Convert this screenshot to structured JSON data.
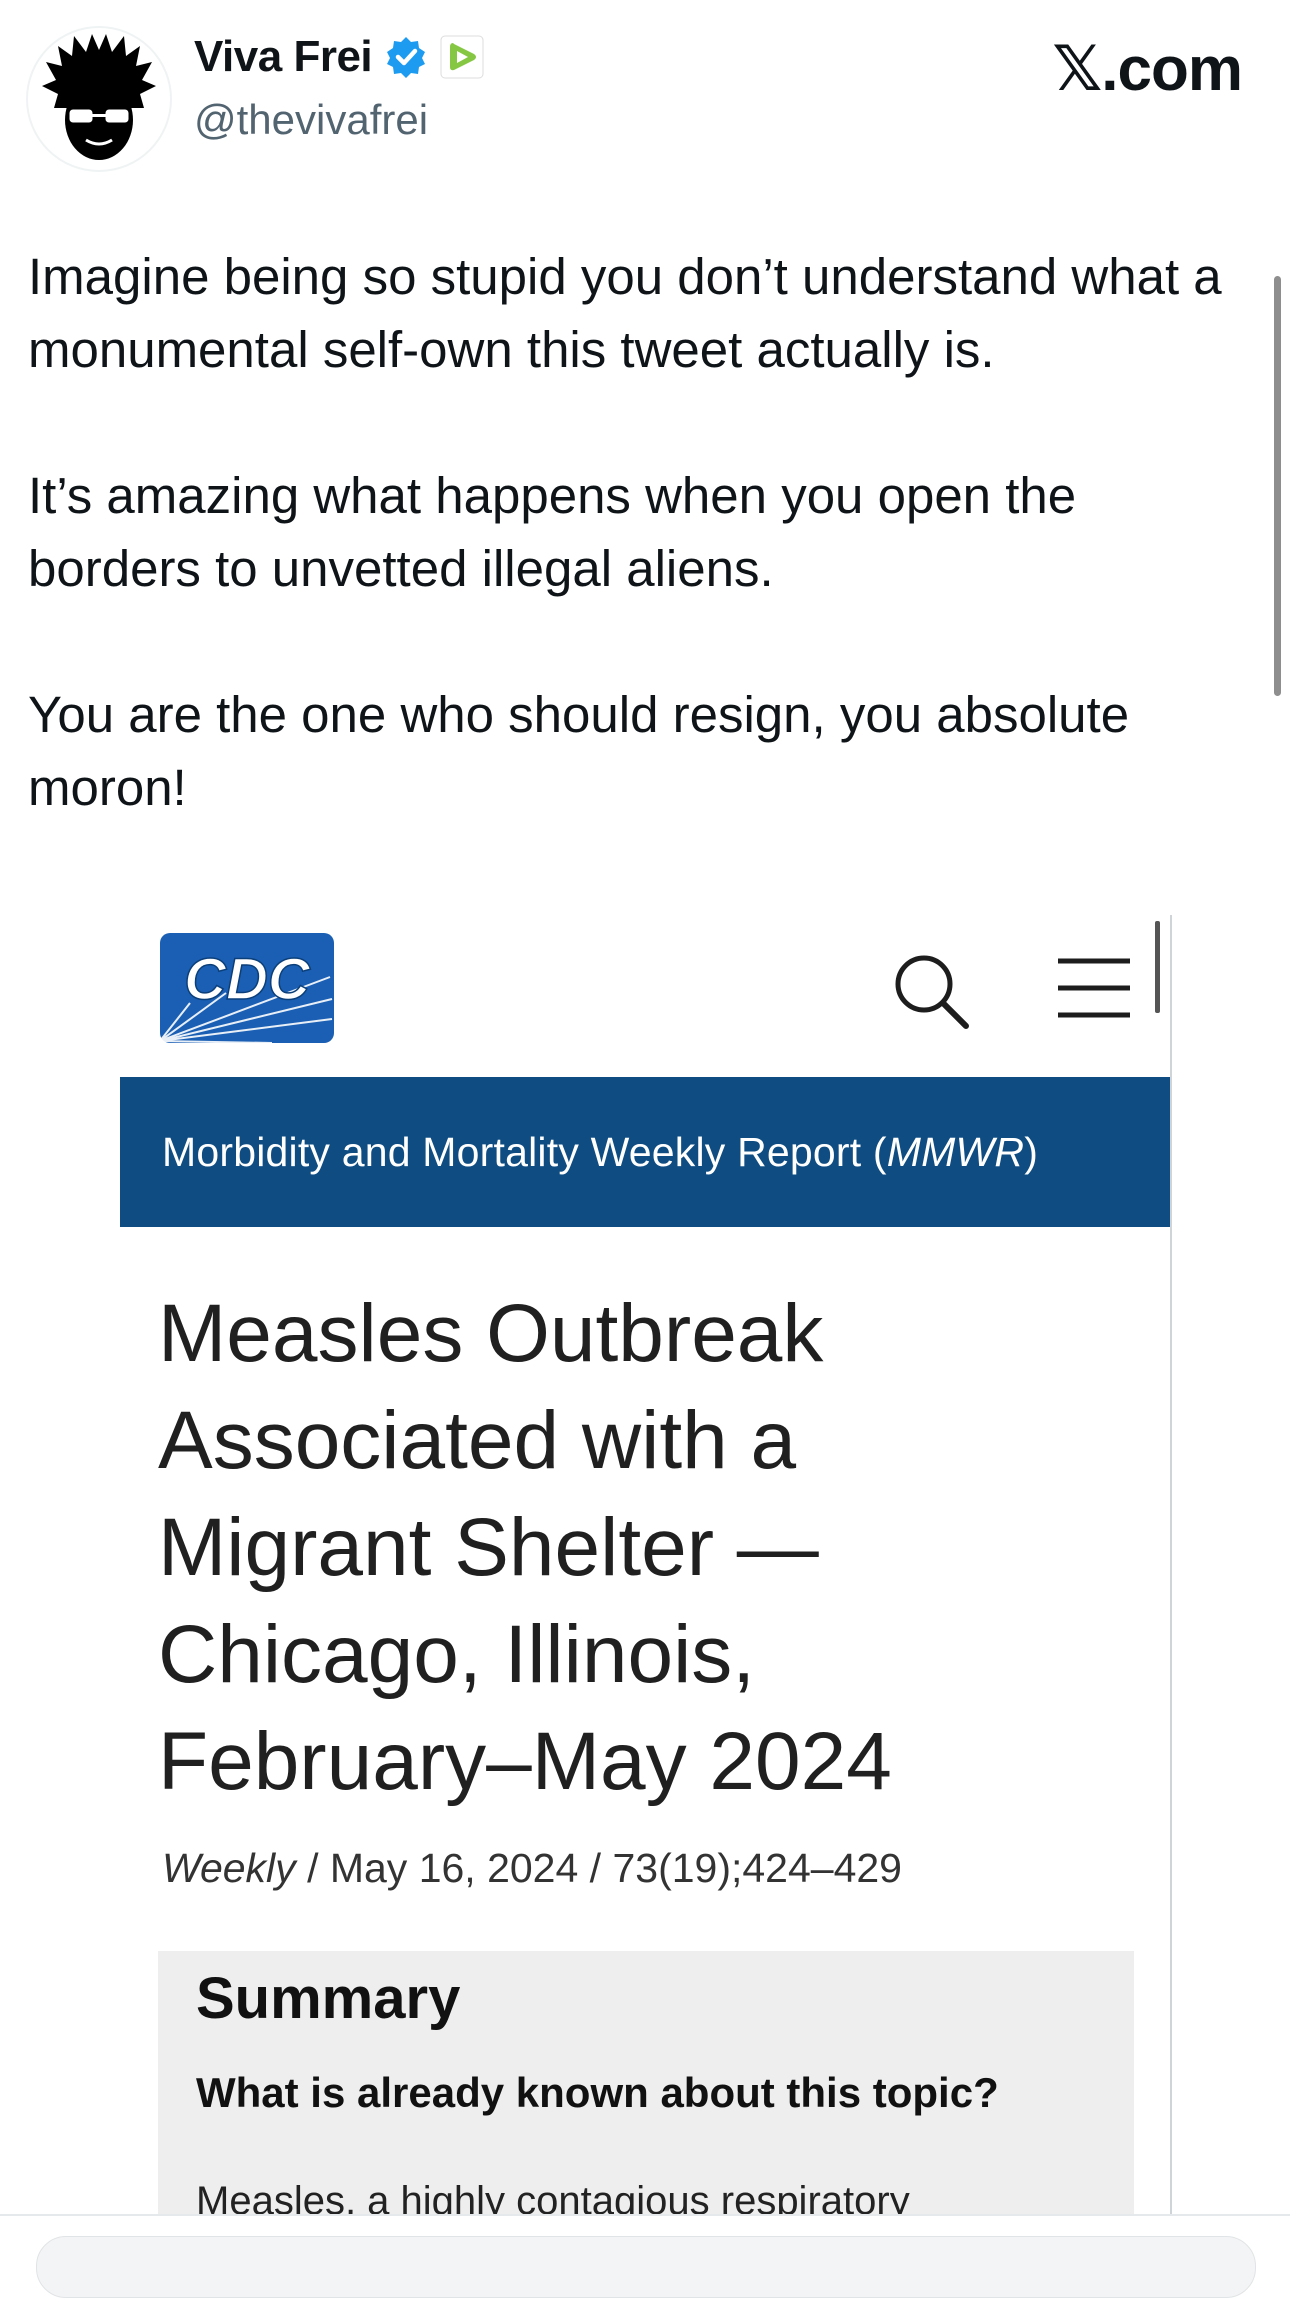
{
  "post": {
    "author_name": "Viva Frei",
    "author_handle": "@thevivafrei",
    "brand": "𝕏.com",
    "text": "Imagine being so stupid you don’t understand what a monumental self-own this tweet actually is.\n\nIt’s amazing what happens when you open the borders to unvetted illegal aliens.\n\nYou are the one who should resign, you absolute moron!",
    "icons": [
      "verified-badge-icon",
      "rumble-badge-icon"
    ]
  },
  "screenshot": {
    "logo_text": "CDC",
    "banner_text": "Morbidity and Mortality Weekly Report (",
    "banner_italic": "MMWR",
    "banner_close": ")",
    "title": "Measles Outbreak\nAssociated with a\nMigrant Shelter —\nChicago, Illinois,\nFebruary–May 2024",
    "meta_italic": "Weekly",
    "meta_rest": " / May 16, 2024 / 73(19);424–429",
    "summary_heading": "Summary",
    "summary_question": "What is already known about this topic?",
    "summary_body": "Measles, a highly contagious respiratory",
    "colors": {
      "banner": "#0e4c82",
      "logo": "#1a5fb4",
      "summary_bg": "#eeeeee"
    }
  }
}
